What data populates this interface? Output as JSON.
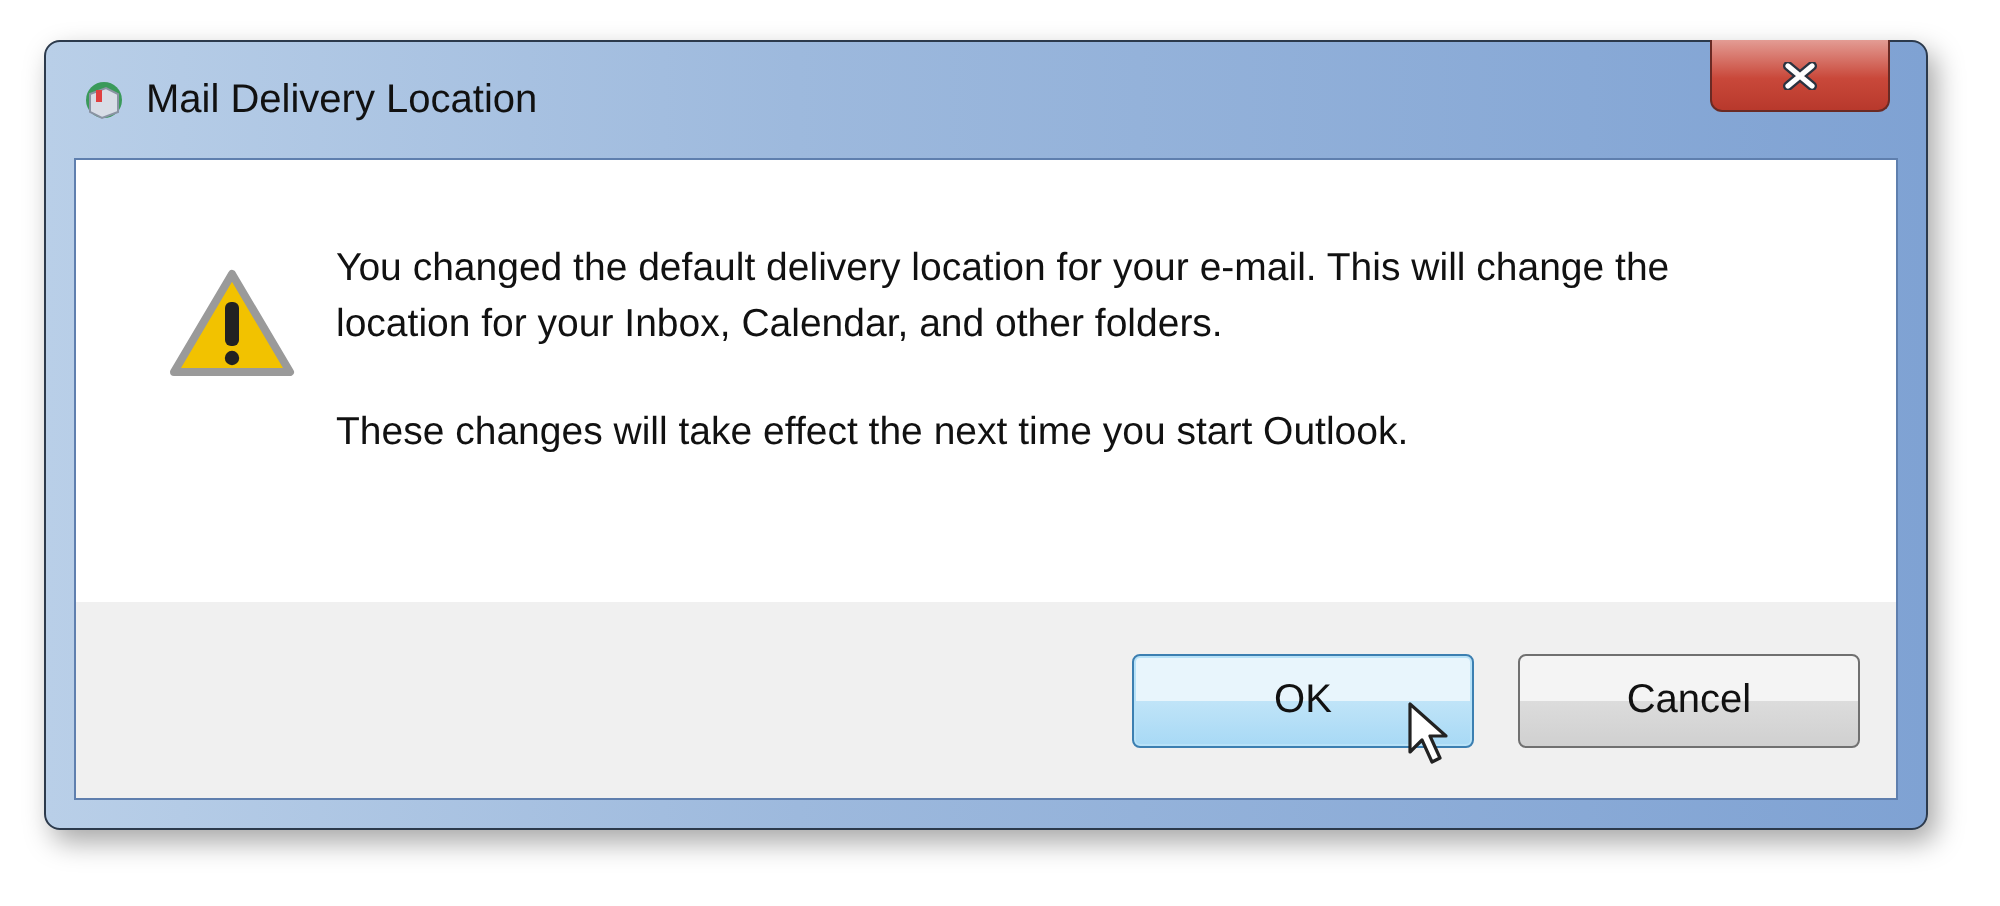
{
  "window": {
    "title": "Mail Delivery Location"
  },
  "message": {
    "paragraphs": [
      "You changed the default delivery location for your e-mail. This will change the location for your Inbox, Calendar, and other folders.",
      "These changes will take effect the next time you start Outlook."
    ]
  },
  "buttons": [
    {
      "label": "OK",
      "selected": true
    },
    {
      "label": "Cancel",
      "selected": false
    }
  ]
}
